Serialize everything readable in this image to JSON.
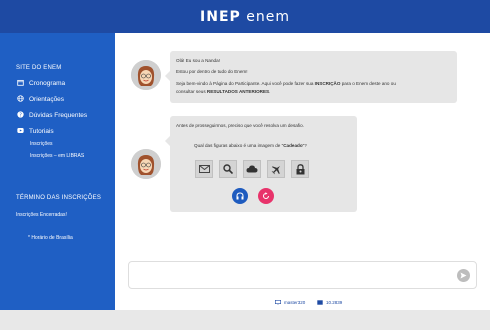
{
  "header": {
    "logo_inep": "INEP",
    "logo_enem": "enem"
  },
  "sidebar": {
    "section_title": "SITE DO ENEM",
    "items": [
      {
        "label": "Cronograma",
        "icon": "calendar-icon"
      },
      {
        "label": "Orientações",
        "icon": "globe-icon"
      },
      {
        "label": "Dúvidas Frequentes",
        "icon": "question-icon"
      },
      {
        "label": "Tutoriais",
        "icon": "play-icon"
      }
    ],
    "subitems": [
      "Inscrições",
      "Inscrições – em LIBRAS"
    ],
    "end_title": "TÉRMINO DAS INSCRIÇÕES",
    "end_status": "Inscrições Encerradas!",
    "timezone_note": "* Horário de Brasília"
  },
  "chat": {
    "message1": {
      "line1": "Olá! Eu sou a Nanda!",
      "line2": "Estou por dentro de tudo do Enem!",
      "line3_a": "Seja bem-vindo à Página do Participante. Aqui você pode fazer sua ",
      "line3_b": "INSCRIÇÃO",
      "line3_c": " para o Enem deste ano ou",
      "line4_a": "consultar seus ",
      "line4_b": "RESULTADOS ANTERIORES",
      "line4_c": "."
    },
    "message2": {
      "line1": "Antes de prosseguirmos, preciso que você resolva um desafio.",
      "question_a": "Qual das figuras abaixo é uma imagem de \"",
      "question_b": "Cadeado",
      "question_c": "\"?",
      "choices": [
        "envelope-icon",
        "search-icon",
        "cloud-icon",
        "airplane-icon",
        "padlock-icon"
      ]
    },
    "audio_button": "headphones-icon",
    "refresh_button": "refresh-icon"
  },
  "input": {
    "placeholder": "",
    "send_icon": "send-icon"
  },
  "footer": {
    "server": "master320",
    "version": "10.2839"
  }
}
